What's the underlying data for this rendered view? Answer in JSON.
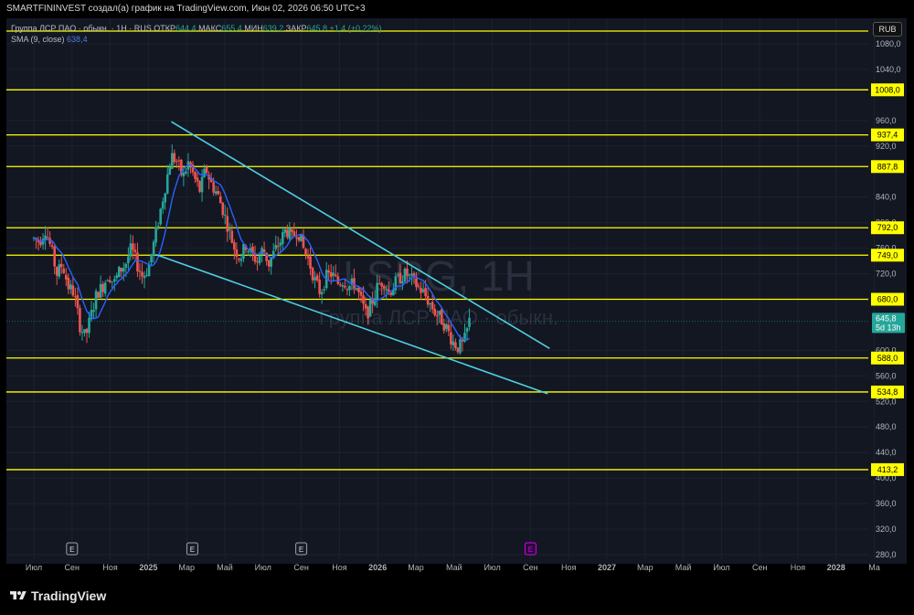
{
  "header": {
    "attribution": "SMARTFININVEST создал(а) график на TradingView.com, Июн 02, 2026 06:50 UTC+3"
  },
  "legend": {
    "symbol": "Группа ЛСР ПАО · обыкн. · 1Н · RUS",
    "open_label": "ОТКР",
    "open": "644,4",
    "high_label": "МАКС",
    "high": "655,4",
    "low_label": "МИН",
    "low": "639,2",
    "close_label": "ЗАКР",
    "close": "645,8",
    "change": "+1,4 (+0,22%)",
    "indicator_label": "SMA (9, close)",
    "indicator_value": "638,4"
  },
  "currency": "RUB",
  "watermark": {
    "ticker": "LSRG, 1H",
    "name": "Группа ЛСР ПАО · обыкн."
  },
  "current_price": {
    "value": 645.8,
    "label": "645,8",
    "countdown": "5d 13h"
  },
  "branding": {
    "logo_text": "TradingView"
  },
  "colors": {
    "background": "#131722",
    "grid": "#1e2230",
    "up": "#26a69a",
    "down": "#ef5350",
    "sma": "#2962ff",
    "level": "#ffff00",
    "trendline": "#4dd0e1",
    "event_purple": "#d500f9"
  },
  "chart_data": {
    "type": "candlestick",
    "ylim": [
      280,
      1100
    ],
    "y_ticks": [
      {
        "value": 280,
        "label": "280,0"
      },
      {
        "value": 320,
        "label": "320,0"
      },
      {
        "value": 360,
        "label": "360,0"
      },
      {
        "value": 400,
        "label": "400,0"
      },
      {
        "value": 440,
        "label": "440,0"
      },
      {
        "value": 480,
        "label": "480,0"
      },
      {
        "value": 520,
        "label": "520,0"
      },
      {
        "value": 560,
        "label": "560,0"
      },
      {
        "value": 600,
        "label": "600,0"
      },
      {
        "value": 720,
        "label": "720,0"
      },
      {
        "value": 760,
        "label": "760,0"
      },
      {
        "value": 800,
        "label": "800,0"
      },
      {
        "value": 840,
        "label": "840,0"
      },
      {
        "value": 920,
        "label": "920,0"
      },
      {
        "value": 960,
        "label": "960,0"
      },
      {
        "value": 1040,
        "label": "1040,0"
      },
      {
        "value": 1080,
        "label": "1080,0"
      }
    ],
    "x_ticks": [
      {
        "t": 0,
        "label": "Июл"
      },
      {
        "t": 2,
        "label": "Сен"
      },
      {
        "t": 4,
        "label": "Ноя"
      },
      {
        "t": 6,
        "label": "2025"
      },
      {
        "t": 8,
        "label": "Мар"
      },
      {
        "t": 10,
        "label": "Май"
      },
      {
        "t": 12,
        "label": "Июл"
      },
      {
        "t": 14,
        "label": "Сен"
      },
      {
        "t": 16,
        "label": "Ноя"
      },
      {
        "t": 18,
        "label": "2026"
      },
      {
        "t": 20,
        "label": "Мар"
      },
      {
        "t": 22,
        "label": "Май"
      },
      {
        "t": 24,
        "label": "Июл"
      },
      {
        "t": 26,
        "label": "Сен"
      },
      {
        "t": 28,
        "label": "Ноя"
      },
      {
        "t": 30,
        "label": "2027"
      },
      {
        "t": 32,
        "label": "Мар"
      },
      {
        "t": 34,
        "label": "Май"
      },
      {
        "t": 36,
        "label": "Июл"
      },
      {
        "t": 38,
        "label": "Сен"
      },
      {
        "t": 40,
        "label": "Ноя"
      },
      {
        "t": 42,
        "label": "2028"
      },
      {
        "t": 44,
        "label": "Ма"
      }
    ],
    "horizontal_levels": [
      {
        "value": 1100,
        "label": ""
      },
      {
        "value": 1008.0,
        "label": "1008,0"
      },
      {
        "value": 937.4,
        "label": "937,4"
      },
      {
        "value": 887.8,
        "label": "887,8"
      },
      {
        "value": 792.0,
        "label": "792,0"
      },
      {
        "value": 749.0,
        "label": "749,0"
      },
      {
        "value": 680.0,
        "label": "680,0"
      },
      {
        "value": 588.0,
        "label": "588,0"
      },
      {
        "value": 534.8,
        "label": "534,8"
      },
      {
        "value": 413.2,
        "label": "413,2"
      }
    ],
    "trendlines": [
      {
        "from": {
          "t": 7.2,
          "v": 958
        },
        "to": {
          "t": 27.0,
          "v": 603
        }
      },
      {
        "from": {
          "t": 6.4,
          "v": 750
        },
        "to": {
          "t": 26.9,
          "v": 532
        }
      }
    ],
    "events": [
      {
        "t": 2.0,
        "label": "E",
        "kind": "earnings"
      },
      {
        "t": 8.3,
        "label": "E",
        "kind": "earnings"
      },
      {
        "t": 14.0,
        "label": "E",
        "kind": "earnings"
      },
      {
        "t": 26.0,
        "label": "E",
        "kind": "earnings-upcoming"
      }
    ],
    "price_anchors": [
      [
        0,
        775
      ],
      [
        0.3,
        770
      ],
      [
        0.6,
        790
      ],
      [
        0.9,
        760
      ],
      [
        1.2,
        720
      ],
      [
        1.5,
        735
      ],
      [
        1.8,
        700
      ],
      [
        2.1,
        690
      ],
      [
        2.4,
        640
      ],
      [
        2.7,
        620
      ],
      [
        3.0,
        655
      ],
      [
        3.3,
        690
      ],
      [
        3.6,
        700
      ],
      [
        3.9,
        720
      ],
      [
        4.2,
        705
      ],
      [
        4.5,
        725
      ],
      [
        4.8,
        735
      ],
      [
        5.1,
        760
      ],
      [
        5.4,
        735
      ],
      [
        5.7,
        715
      ],
      [
        6.0,
        730
      ],
      [
        6.3,
        770
      ],
      [
        6.6,
        815
      ],
      [
        6.9,
        860
      ],
      [
        7.2,
        905
      ],
      [
        7.5,
        895
      ],
      [
        7.8,
        870
      ],
      [
        8.1,
        895
      ],
      [
        8.4,
        870
      ],
      [
        8.7,
        850
      ],
      [
        9.0,
        885
      ],
      [
        9.3,
        860
      ],
      [
        9.6,
        845
      ],
      [
        9.9,
        820
      ],
      [
        10.2,
        790
      ],
      [
        10.5,
        760
      ],
      [
        10.8,
        745
      ],
      [
        11.1,
        765
      ],
      [
        11.4,
        750
      ],
      [
        11.7,
        740
      ],
      [
        12.0,
        760
      ],
      [
        12.3,
        735
      ],
      [
        12.6,
        755
      ],
      [
        12.9,
        770
      ],
      [
        13.2,
        790
      ],
      [
        13.5,
        775
      ],
      [
        13.8,
        790
      ],
      [
        14.1,
        760
      ],
      [
        14.4,
        740
      ],
      [
        14.7,
        710
      ],
      [
        15.0,
        690
      ],
      [
        15.3,
        715
      ],
      [
        15.6,
        720
      ],
      [
        15.9,
        705
      ],
      [
        16.2,
        710
      ],
      [
        16.5,
        700
      ],
      [
        16.8,
        705
      ],
      [
        17.1,
        680
      ],
      [
        17.4,
        655
      ],
      [
        17.7,
        675
      ],
      [
        18.0,
        700
      ],
      [
        18.3,
        710
      ],
      [
        18.6,
        690
      ],
      [
        18.9,
        705
      ],
      [
        19.2,
        715
      ],
      [
        19.5,
        720
      ],
      [
        19.8,
        710
      ],
      [
        20.1,
        700
      ],
      [
        20.4,
        690
      ],
      [
        20.7,
        675
      ],
      [
        21.0,
        660
      ],
      [
        21.3,
        650
      ],
      [
        21.6,
        635
      ],
      [
        21.9,
        615
      ],
      [
        22.2,
        605
      ],
      [
        22.5,
        610
      ],
      [
        22.8,
        646
      ]
    ]
  }
}
